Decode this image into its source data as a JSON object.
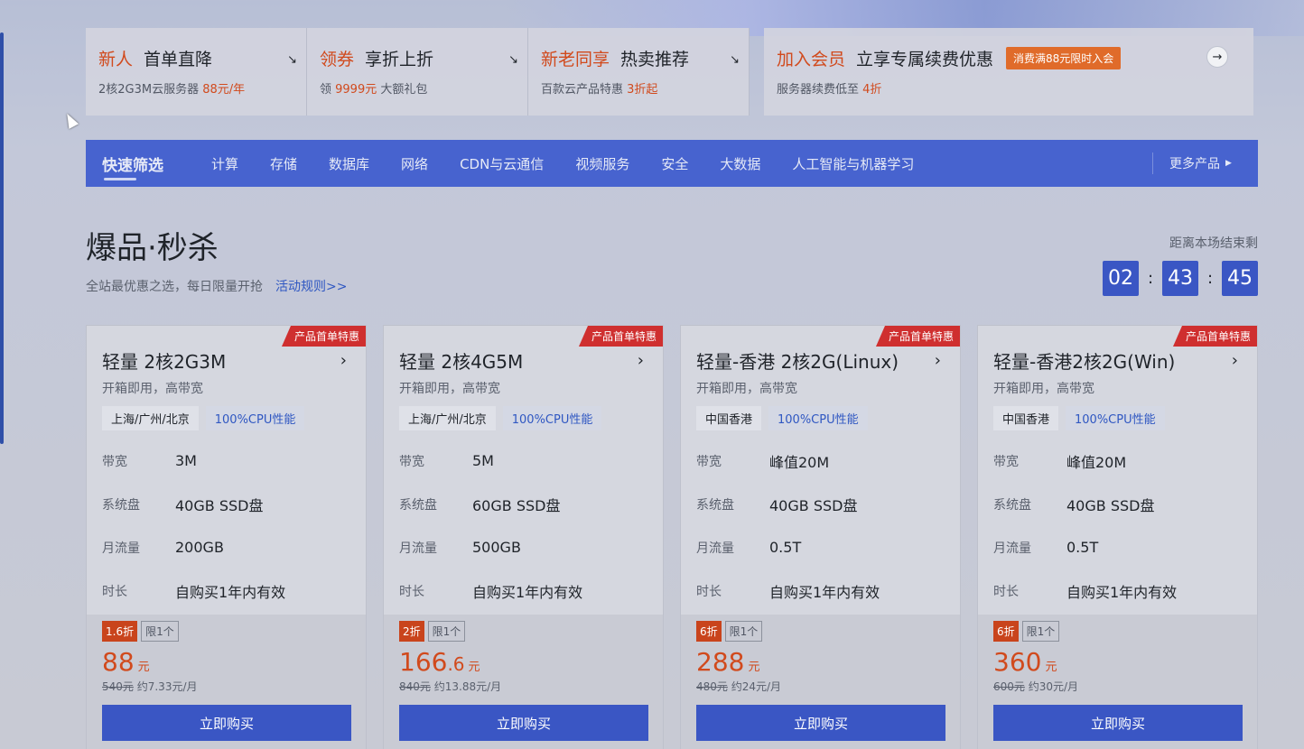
{
  "promo": [
    {
      "hl": "新人",
      "title": "首单直降",
      "sub_pre": "2核2G3M云服务器 ",
      "sub_red": "88元/年",
      "sub_post": "",
      "arrow": "↘"
    },
    {
      "hl": "领券",
      "title": "享折上折",
      "sub_pre": "领 ",
      "sub_red": "9999元",
      "sub_post": " 大额礼包",
      "arrow": "↘"
    },
    {
      "hl": "新老同享",
      "title": "热卖推荐",
      "sub_pre": "百款云产品特惠 ",
      "sub_red": "3折起",
      "sub_post": "",
      "arrow": "↘"
    },
    {
      "hl": "加入会员",
      "title": "立享专属续费优惠",
      "badge": "消费满88元限时入会",
      "sub_pre": "服务器续费低至 ",
      "sub_red": "4折",
      "sub_post": "",
      "arrow": "→"
    }
  ],
  "nav": {
    "quick": "快速筛选",
    "items": [
      "计算",
      "存储",
      "数据库",
      "网络",
      "CDN与云通信",
      "视频服务",
      "安全",
      "大数据",
      "人工智能与机器学习"
    ],
    "more": "更多产品"
  },
  "section": {
    "title": "爆品·秒杀",
    "subtitle": "全站最优惠之选，每日限量开抢",
    "rules_link": "活动规则>>",
    "countdown_label": "距离本场结束剩",
    "countdown": [
      "02",
      "43",
      "45"
    ]
  },
  "cards": [
    {
      "ribbon": "产品首单特惠",
      "name": "轻量 2核2G3M",
      "desc": "开箱即用，高带宽",
      "region": "上海/广州/北京",
      "cpu": "100%CPU性能",
      "specs": [
        {
          "k": "带宽",
          "v": "3M"
        },
        {
          "k": "系统盘",
          "v": "40GB SSD盘"
        },
        {
          "k": "月流量",
          "v": "200GB"
        },
        {
          "k": "时长",
          "v": "自购买1年内有效"
        }
      ],
      "discount": "1.6折",
      "limit": "限1个",
      "price_int": "88",
      "price_dec": "",
      "unit": "元",
      "orig": "540元",
      "monthly": "约7.33元/月",
      "buy": "立即购买"
    },
    {
      "ribbon": "产品首单特惠",
      "name": "轻量 2核4G5M",
      "desc": "开箱即用，高带宽",
      "region": "上海/广州/北京",
      "cpu": "100%CPU性能",
      "specs": [
        {
          "k": "带宽",
          "v": "5M"
        },
        {
          "k": "系统盘",
          "v": "60GB SSD盘"
        },
        {
          "k": "月流量",
          "v": "500GB"
        },
        {
          "k": "时长",
          "v": "自购买1年内有效"
        }
      ],
      "discount": "2折",
      "limit": "限1个",
      "price_int": "166",
      "price_dec": ".6",
      "unit": "元",
      "orig": "840元",
      "monthly": "约13.88元/月",
      "buy": "立即购买"
    },
    {
      "ribbon": "产品首单特惠",
      "name": "轻量-香港 2核2G(Linux)",
      "desc": "开箱即用，高带宽",
      "region": "中国香港",
      "cpu": "100%CPU性能",
      "specs": [
        {
          "k": "带宽",
          "v": "峰值20M"
        },
        {
          "k": "系统盘",
          "v": "40GB SSD盘"
        },
        {
          "k": "月流量",
          "v": "0.5T"
        },
        {
          "k": "时长",
          "v": "自购买1年内有效"
        }
      ],
      "discount": "6折",
      "limit": "限1个",
      "price_int": "288",
      "price_dec": "",
      "unit": "元",
      "orig": "480元",
      "monthly": "约24元/月",
      "buy": "立即购买"
    },
    {
      "ribbon": "产品首单特惠",
      "name": "轻量-香港2核2G(Win)",
      "desc": "开箱即用，高带宽",
      "region": "中国香港",
      "cpu": "100%CPU性能",
      "specs": [
        {
          "k": "带宽",
          "v": "峰值20M"
        },
        {
          "k": "系统盘",
          "v": "40GB SSD盘"
        },
        {
          "k": "月流量",
          "v": "0.5T"
        },
        {
          "k": "时长",
          "v": "自购买1年内有效"
        }
      ],
      "discount": "6折",
      "limit": "限1个",
      "price_int": "360",
      "price_dec": "",
      "unit": "元",
      "orig": "600元",
      "monthly": "约30元/月",
      "buy": "立即购买"
    }
  ]
}
